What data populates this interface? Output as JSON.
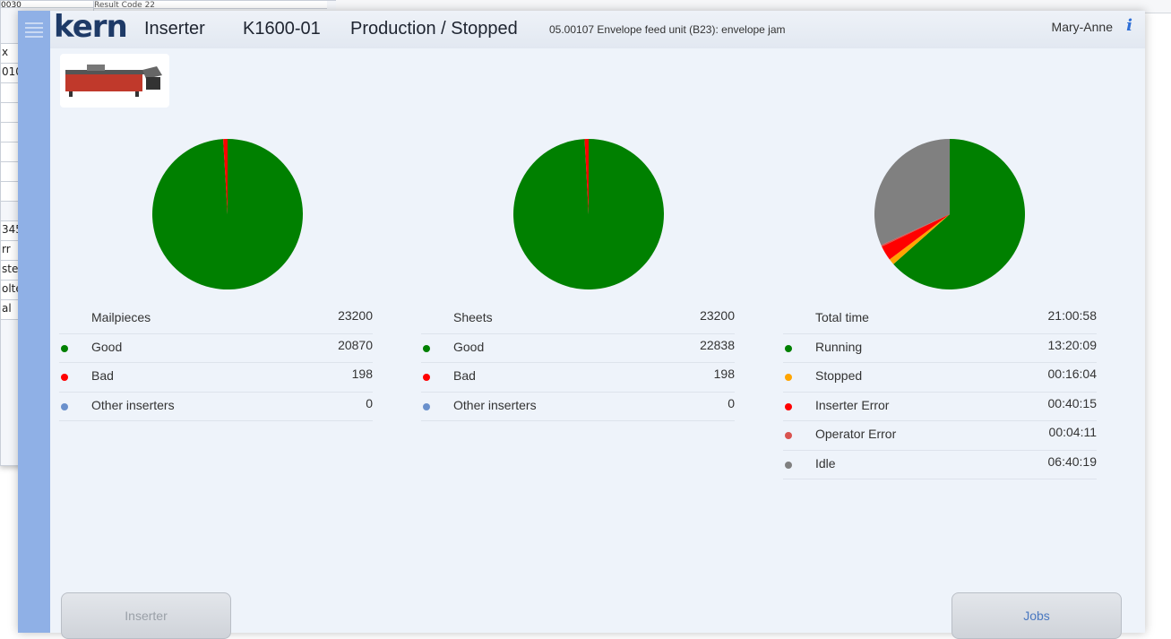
{
  "background_window": {
    "top_cell": "Result Code  22",
    "cells": [
      "0030",
      "",
      "x",
      "010",
      "",
      "",
      "",
      "",
      "",
      "",
      "",
      "345",
      "rr",
      "ste",
      "olte",
      "al"
    ]
  },
  "header": {
    "logo": "kern",
    "app": "Inserter",
    "machine_id": "K1600-01",
    "state": "Production / Stopped",
    "message": "05.00107 Envelope feed unit (B23): envelope jam",
    "user": "Mary-Anne",
    "info_icon": "i"
  },
  "colors": {
    "good": "#008000",
    "bad": "#ff0000",
    "other": "#6a90cc",
    "stopped": "#ffa500",
    "operator_error": "#d9534f",
    "idle": "#808080"
  },
  "mailpieces": {
    "title": "Mailpieces",
    "total": "23200",
    "rows": [
      {
        "label": "Good",
        "value": "20870",
        "color": "#008000"
      },
      {
        "label": "Bad",
        "value": "198",
        "color": "#ff0000"
      },
      {
        "label": "Other inserters",
        "value": "0",
        "color": "#6a90cc"
      }
    ]
  },
  "sheets": {
    "title": "Sheets",
    "total": "23200",
    "rows": [
      {
        "label": "Good",
        "value": "22838",
        "color": "#008000"
      },
      {
        "label": "Bad",
        "value": "198",
        "color": "#ff0000"
      },
      {
        "label": "Other inserters",
        "value": "0",
        "color": "#6a90cc"
      }
    ]
  },
  "time": {
    "title": "Total time",
    "total": "21:00:58",
    "rows": [
      {
        "label": "Running",
        "value": "13:20:09",
        "color": "#008000"
      },
      {
        "label": "Stopped",
        "value": "00:16:04",
        "color": "#ffa500"
      },
      {
        "label": "Inserter Error",
        "value": "00:40:15",
        "color": "#ff0000"
      },
      {
        "label": "Operator Error",
        "value": "00:04:11",
        "color": "#d9534f"
      },
      {
        "label": "Idle",
        "value": "06:40:19",
        "color": "#808080"
      }
    ]
  },
  "chart_data": [
    {
      "type": "pie",
      "categories": [
        "Good",
        "Bad",
        "Other inserters"
      ],
      "values": [
        20870,
        198,
        0
      ]
    },
    {
      "type": "pie",
      "categories": [
        "Good",
        "Bad",
        "Other inserters"
      ],
      "values": [
        22838,
        198,
        0
      ]
    },
    {
      "type": "pie",
      "categories": [
        "Running",
        "Stopped",
        "Inserter Error",
        "Operator Error",
        "Idle"
      ],
      "values": [
        48009,
        964,
        2415,
        251,
        24019
      ]
    }
  ],
  "buttons": {
    "inserter": "Inserter",
    "jobs": "Jobs"
  }
}
